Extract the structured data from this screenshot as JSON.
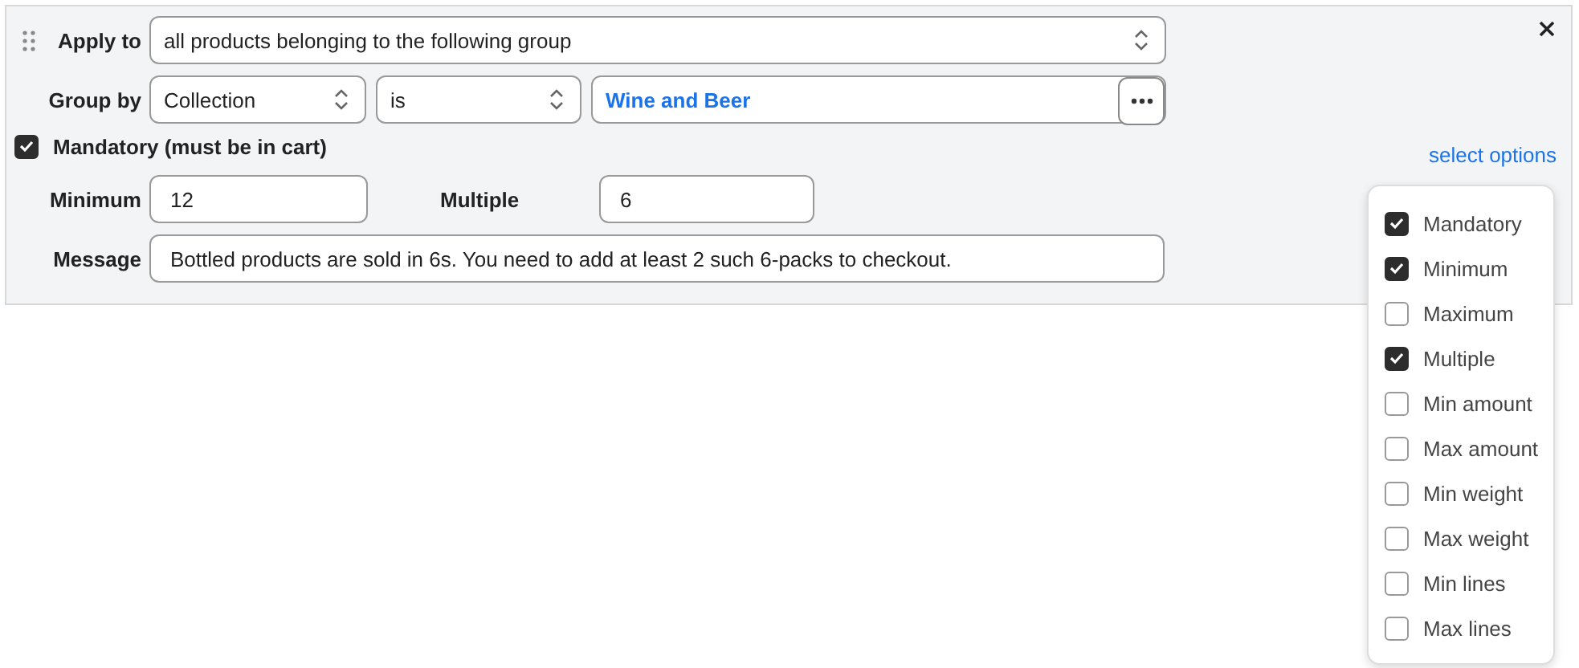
{
  "rule": {
    "apply_to": {
      "label": "Apply to",
      "value": "all products belonging to the following group"
    },
    "group_by": {
      "label": "Group by",
      "field": "Collection",
      "operator": "is",
      "value": "Wine and Beer"
    },
    "mandatory": {
      "label": "Mandatory (must be in cart)",
      "checked": true
    },
    "select_options": "select options",
    "minimum": {
      "label": "Minimum",
      "value": "12"
    },
    "multiple": {
      "label": "Multiple",
      "value": "6"
    },
    "message": {
      "label": "Message",
      "value": "Bottled products are sold in 6s. You need to add at least 2 such 6-packs to checkout."
    }
  },
  "options_menu": {
    "items": [
      {
        "label": "Mandatory",
        "checked": true
      },
      {
        "label": "Minimum",
        "checked": true
      },
      {
        "label": "Maximum",
        "checked": false
      },
      {
        "label": "Multiple",
        "checked": true
      },
      {
        "label": "Min amount",
        "checked": false
      },
      {
        "label": "Max amount",
        "checked": false
      },
      {
        "label": "Min weight",
        "checked": false
      },
      {
        "label": "Max weight",
        "checked": false
      },
      {
        "label": "Min lines",
        "checked": false
      },
      {
        "label": "Max lines",
        "checked": false
      }
    ]
  }
}
